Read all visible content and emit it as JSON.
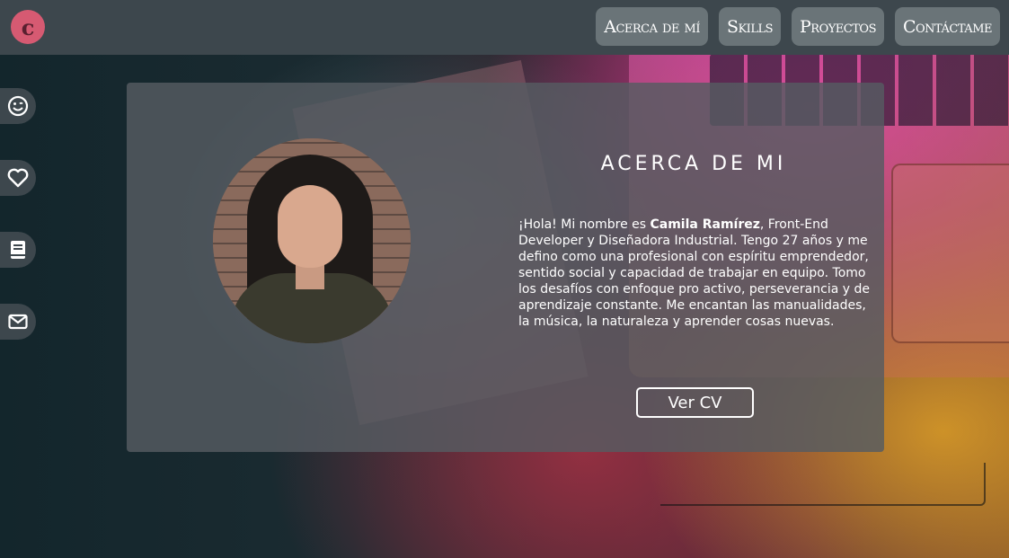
{
  "header": {
    "logo_letter": "c",
    "nav": [
      "Acerca de mí",
      "Skills",
      "Proyectos",
      "Contáctame"
    ]
  },
  "sidebar": {
    "items": [
      {
        "icon": "smile-icon"
      },
      {
        "icon": "heart-icon"
      },
      {
        "icon": "book-icon"
      },
      {
        "icon": "envelope-icon"
      }
    ]
  },
  "about": {
    "title": "ACERCA DE MI",
    "greeting": "¡Hola! Mi nombre es ",
    "name": "Camila Ramírez",
    "bio_rest": ", Front-End Developer y Diseñadora Industrial. Tengo 27 años y me defino como una profesional con espíritu emprendedor, sentido social y capacidad de trabajar en equipo. Tomo los desafíos con enfoque pro activo, perseverancia y de aprendizaje constante. Me encantan las manualidades, la música, la naturaleza y aprender cosas nuevas.",
    "cv_button": "Ver CV"
  },
  "colors": {
    "header_bg": "#3d474d",
    "nav_button_bg": "#6a7478",
    "logo_bg": "#d65a72",
    "card_bg": "#555c62"
  }
}
